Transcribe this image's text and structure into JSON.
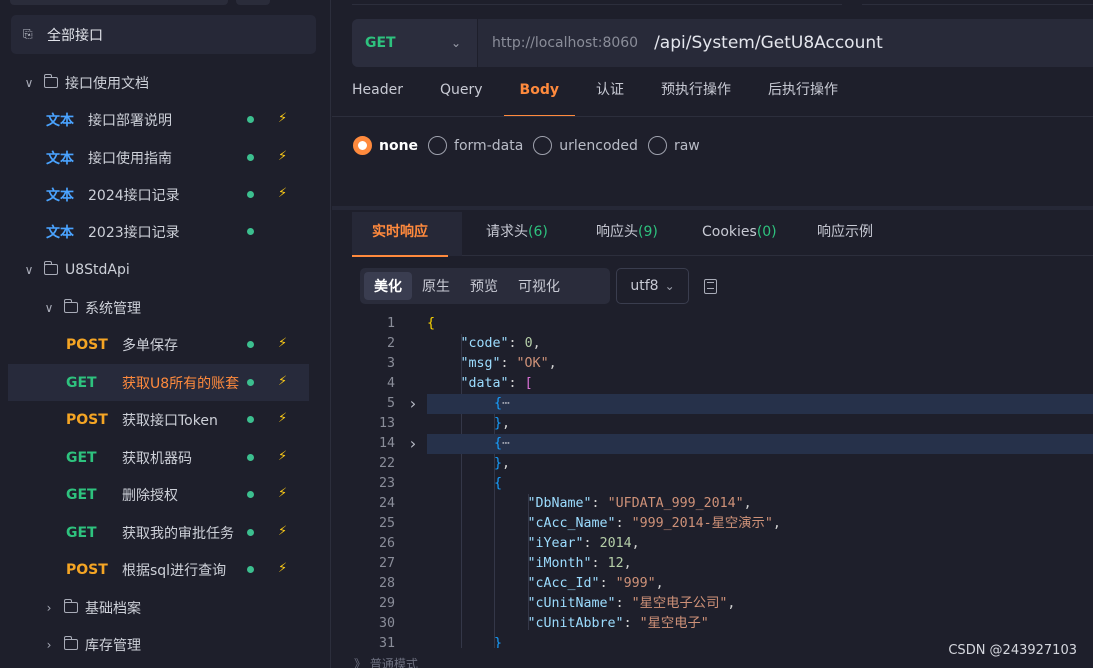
{
  "sidebar": {
    "all_api_label": "全部接口",
    "items": [
      {
        "kind": "folder",
        "expanded": true,
        "label": "接口使用文档"
      },
      {
        "kind": "doc",
        "tag": "文本",
        "label": "接口部署说明",
        "dot": true,
        "bolt": true
      },
      {
        "kind": "doc",
        "tag": "文本",
        "label": "接口使用指南",
        "dot": true,
        "bolt": true
      },
      {
        "kind": "doc",
        "tag": "文本",
        "label": "2024接口记录",
        "dot": true,
        "bolt": true
      },
      {
        "kind": "doc",
        "tag": "文本",
        "label": "2023接口记录",
        "dot": true,
        "bolt": false
      },
      {
        "kind": "folder",
        "expanded": true,
        "label": "U8StdApi"
      },
      {
        "kind": "folder",
        "expanded": true,
        "label": "系统管理"
      },
      {
        "kind": "api",
        "method": "POST",
        "label": "多单保存",
        "dot": true,
        "bolt": true
      },
      {
        "kind": "api",
        "method": "GET",
        "label": "获取U8所有的账套",
        "dot": true,
        "bolt": true,
        "active": true
      },
      {
        "kind": "api",
        "method": "POST",
        "label": "获取接口Token",
        "dot": true,
        "bolt": true
      },
      {
        "kind": "api",
        "method": "GET",
        "label": "获取机器码",
        "dot": true,
        "bolt": true
      },
      {
        "kind": "api",
        "method": "GET",
        "label": "删除授权",
        "dot": true,
        "bolt": true
      },
      {
        "kind": "api",
        "method": "GET",
        "label": "获取我的审批任务",
        "dot": true,
        "bolt": true
      },
      {
        "kind": "api",
        "method": "POST",
        "label": "根据sql进行查询",
        "dot": true,
        "bolt": true
      },
      {
        "kind": "folder",
        "expanded": false,
        "label": "基础档案"
      },
      {
        "kind": "folder",
        "expanded": false,
        "label": "库存管理"
      }
    ]
  },
  "request": {
    "method": "GET",
    "base_url": "http://localhost:8060",
    "path": "/api/System/GetU8Account",
    "tabs": [
      "Header",
      "Query",
      "Body",
      "认证",
      "预执行操作",
      "后执行操作"
    ],
    "active_tab": "Body",
    "body_types": [
      "none",
      "form-data",
      "urlencoded",
      "raw"
    ],
    "body_selected": "none"
  },
  "response": {
    "tabs": [
      {
        "label": "实时响应",
        "count": ""
      },
      {
        "label": "请求头",
        "count": "(6)"
      },
      {
        "label": "响应头",
        "count": "(9)"
      },
      {
        "label": "Cookies",
        "count": "(0)"
      },
      {
        "label": "响应示例",
        "count": ""
      }
    ],
    "view_modes": [
      "美化",
      "原生",
      "预览",
      "可视化"
    ],
    "active_view": "美化",
    "encoding": "utf8",
    "code_lines": [
      {
        "n": "1",
        "fold": "",
        "hl": false,
        "indent": 0,
        "tokens": [
          [
            "brace",
            "{"
          ]
        ]
      },
      {
        "n": "2",
        "fold": "",
        "hl": false,
        "indent": 1,
        "tokens": [
          [
            "key",
            "\"code\""
          ],
          [
            "punc",
            ": "
          ],
          [
            "num",
            "0"
          ],
          [
            "punc",
            ","
          ]
        ]
      },
      {
        "n": "3",
        "fold": "",
        "hl": false,
        "indent": 1,
        "tokens": [
          [
            "key",
            "\"msg\""
          ],
          [
            "punc",
            ": "
          ],
          [
            "str",
            "\"OK\""
          ],
          [
            "punc",
            ","
          ]
        ]
      },
      {
        "n": "4",
        "fold": "",
        "hl": false,
        "indent": 1,
        "tokens": [
          [
            "key",
            "\"data\""
          ],
          [
            "punc",
            ": "
          ],
          [
            "brack",
            "["
          ]
        ]
      },
      {
        "n": "5",
        "fold": ">",
        "hl": true,
        "indent": 2,
        "tokens": [
          [
            "brace2",
            "{"
          ],
          [
            "ell",
            "⋯"
          ]
        ]
      },
      {
        "n": "13",
        "fold": "",
        "hl": false,
        "indent": 2,
        "tokens": [
          [
            "brace2",
            "}"
          ],
          [
            "punc",
            ","
          ]
        ]
      },
      {
        "n": "14",
        "fold": ">",
        "hl": true,
        "indent": 2,
        "tokens": [
          [
            "brace2",
            "{"
          ],
          [
            "ell",
            "⋯"
          ]
        ]
      },
      {
        "n": "22",
        "fold": "",
        "hl": false,
        "indent": 2,
        "tokens": [
          [
            "brace2",
            "}"
          ],
          [
            "punc",
            ","
          ]
        ]
      },
      {
        "n": "23",
        "fold": "",
        "hl": false,
        "indent": 2,
        "tokens": [
          [
            "brace2",
            "{"
          ]
        ]
      },
      {
        "n": "24",
        "fold": "",
        "hl": false,
        "indent": 3,
        "tokens": [
          [
            "key",
            "\"DbName\""
          ],
          [
            "punc",
            ": "
          ],
          [
            "str",
            "\"UFDATA_999_2014\""
          ],
          [
            "punc",
            ","
          ]
        ]
      },
      {
        "n": "25",
        "fold": "",
        "hl": false,
        "indent": 3,
        "tokens": [
          [
            "key",
            "\"cAcc_Name\""
          ],
          [
            "punc",
            ": "
          ],
          [
            "str",
            "\"999_2014-星空演示\""
          ],
          [
            "punc",
            ","
          ]
        ]
      },
      {
        "n": "26",
        "fold": "",
        "hl": false,
        "indent": 3,
        "tokens": [
          [
            "key",
            "\"iYear\""
          ],
          [
            "punc",
            ": "
          ],
          [
            "num",
            "2014"
          ],
          [
            "punc",
            ","
          ]
        ]
      },
      {
        "n": "27",
        "fold": "",
        "hl": false,
        "indent": 3,
        "tokens": [
          [
            "key",
            "\"iMonth\""
          ],
          [
            "punc",
            ": "
          ],
          [
            "num",
            "12"
          ],
          [
            "punc",
            ","
          ]
        ]
      },
      {
        "n": "28",
        "fold": "",
        "hl": false,
        "indent": 3,
        "tokens": [
          [
            "key",
            "\"cAcc_Id\""
          ],
          [
            "punc",
            ": "
          ],
          [
            "str",
            "\"999\""
          ],
          [
            "punc",
            ","
          ]
        ]
      },
      {
        "n": "29",
        "fold": "",
        "hl": false,
        "indent": 3,
        "tokens": [
          [
            "key",
            "\"cUnitName\""
          ],
          [
            "punc",
            ": "
          ],
          [
            "str",
            "\"星空电子公司\""
          ],
          [
            "punc",
            ","
          ]
        ]
      },
      {
        "n": "30",
        "fold": "",
        "hl": false,
        "indent": 3,
        "tokens": [
          [
            "key",
            "\"cUnitAbbre\""
          ],
          [
            "punc",
            ": "
          ],
          [
            "str",
            "\"星空电子\""
          ]
        ]
      },
      {
        "n": "31",
        "fold": "",
        "hl": false,
        "indent": 2,
        "tokens": [
          [
            "brace2",
            "}"
          ]
        ]
      }
    ]
  },
  "footer": {
    "mode_text": "》 普通模式"
  },
  "watermark": "CSDN @243927103"
}
